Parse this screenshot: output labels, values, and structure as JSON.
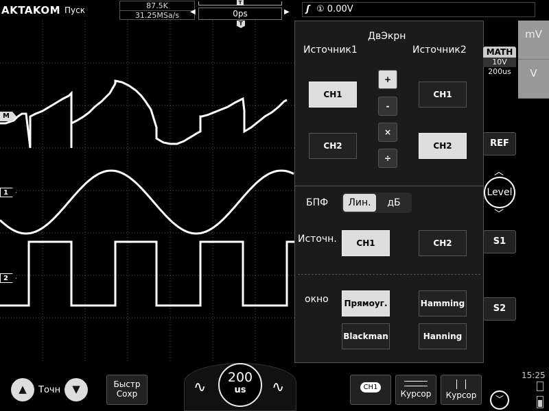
{
  "topbar": {
    "logo": "AKTAKOM",
    "run_status": "Пуск",
    "memory_depth": "87.5K",
    "sample_rate": "31.25MSa/s",
    "delay": "0ps",
    "trigger_source": "①",
    "trigger_level": "0.00V"
  },
  "markers": {
    "math": "M",
    "ch1": "1",
    "ch2": "2",
    "trigger": "T"
  },
  "panel": {
    "dual_label": "ДвЭкрн",
    "source1_label": "Источник1",
    "source2_label": "Источник2",
    "source1_ch1": "CH1",
    "source1_ch2": "CH2",
    "source2_ch1": "CH1",
    "source2_ch2": "CH2",
    "ops": [
      "+",
      "-",
      "×",
      "÷"
    ],
    "fft_label": "БПФ",
    "fft_modes": [
      "Лин.",
      "дБ"
    ],
    "fft_source_label": "Источн.",
    "fft_source_ch1": "CH1",
    "fft_source_ch2": "CH2",
    "window_label": "окно",
    "windows": [
      "Прямоуг.",
      "Hamming",
      "Blackman",
      "Hanning"
    ]
  },
  "side": {
    "math_title": "MATH",
    "math_scale": "10V",
    "math_timebase": "200us",
    "unit_top": "mV",
    "unit_bottom": "V",
    "ref_label": "REF",
    "level_label": "Level",
    "s1_label": "S1",
    "s2_label": "S2"
  },
  "bottom": {
    "fine_label": "Точн",
    "quick_save_line1": "Быстр",
    "quick_save_line2": "Сохр",
    "timebase_value": "200",
    "timebase_unit": "us",
    "channel_badge": "CH1",
    "cursor_h_label": "Курсор",
    "cursor_v_label": "Курсор",
    "clock": "15:25"
  },
  "colors": {
    "background": "#000000",
    "panel": "#1b1b1b",
    "selected": "#dddddd",
    "trace": "#ffffff"
  }
}
